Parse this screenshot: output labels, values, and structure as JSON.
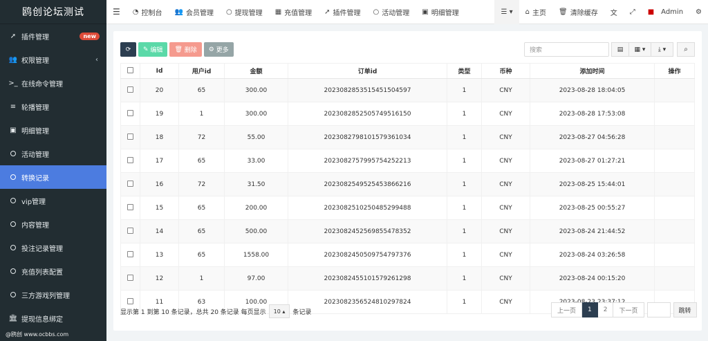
{
  "brand": "鸥创论坛测试",
  "sidebar": {
    "items": [
      {
        "label": "插件管理",
        "badge": "new"
      },
      {
        "label": "权限管理"
      },
      {
        "label": "在线命令管理"
      },
      {
        "label": "轮播管理"
      },
      {
        "label": "明细管理"
      },
      {
        "label": "活动管理"
      },
      {
        "label": "转换记录"
      },
      {
        "label": "vip管理"
      },
      {
        "label": "内容管理"
      },
      {
        "label": "投注记录管理"
      },
      {
        "label": "充值列表配置"
      },
      {
        "label": "三方游戏列管理"
      },
      {
        "label": "提现信息绑定"
      }
    ],
    "watermark": "@鸥创 www.ocbbs.com"
  },
  "topbar": {
    "nav": [
      "控制台",
      "会员管理",
      "提现管理",
      "充值管理",
      "插件管理",
      "活动管理",
      "明细管理"
    ],
    "home": "主页",
    "clear_cache": "清除缓存",
    "user": "Admin"
  },
  "toolbar": {
    "edit": "编辑",
    "delete": "删除",
    "more": "更多",
    "search_placeholder": "搜索"
  },
  "table": {
    "headers": [
      "Id",
      "用户id",
      "金额",
      "订单id",
      "类型",
      "币种",
      "添加时间",
      "操作"
    ],
    "rows": [
      [
        "20",
        "65",
        "300.00",
        "2023082853515451504597",
        "1",
        "CNY",
        "2023-08-28 18:04:05"
      ],
      [
        "19",
        "1",
        "300.00",
        "2023082852505749516150",
        "1",
        "CNY",
        "2023-08-28 17:53:08"
      ],
      [
        "18",
        "72",
        "55.00",
        "2023082798101579361034",
        "1",
        "CNY",
        "2023-08-27 04:56:28"
      ],
      [
        "17",
        "65",
        "33.00",
        "2023082757995754252213",
        "1",
        "CNY",
        "2023-08-27 01:27:21"
      ],
      [
        "16",
        "72",
        "31.50",
        "2023082549525453866216",
        "1",
        "CNY",
        "2023-08-25 15:44:01"
      ],
      [
        "15",
        "65",
        "200.00",
        "2023082510250485299488",
        "1",
        "CNY",
        "2023-08-25 00:55:27"
      ],
      [
        "14",
        "65",
        "500.00",
        "2023082452569855478352",
        "1",
        "CNY",
        "2023-08-24 21:44:52"
      ],
      [
        "13",
        "65",
        "1558.00",
        "2023082450509754797376",
        "1",
        "CNY",
        "2023-08-24 03:26:58"
      ],
      [
        "12",
        "1",
        "97.00",
        "2023082455101579261298",
        "1",
        "CNY",
        "2023-08-24 00:15:20"
      ],
      [
        "11",
        "63",
        "100.00",
        "2023082356524810297824",
        "1",
        "CNY",
        "2023-08-23 23:37:12"
      ]
    ]
  },
  "footer": {
    "summary": "显示第 1 到第 10 条记录，总共 20 条记录 每页显示",
    "page_size": "10",
    "suffix": "条记录",
    "prev": "上一页",
    "pages": [
      "1",
      "2"
    ],
    "next": "下一页",
    "jump": "跳转"
  }
}
